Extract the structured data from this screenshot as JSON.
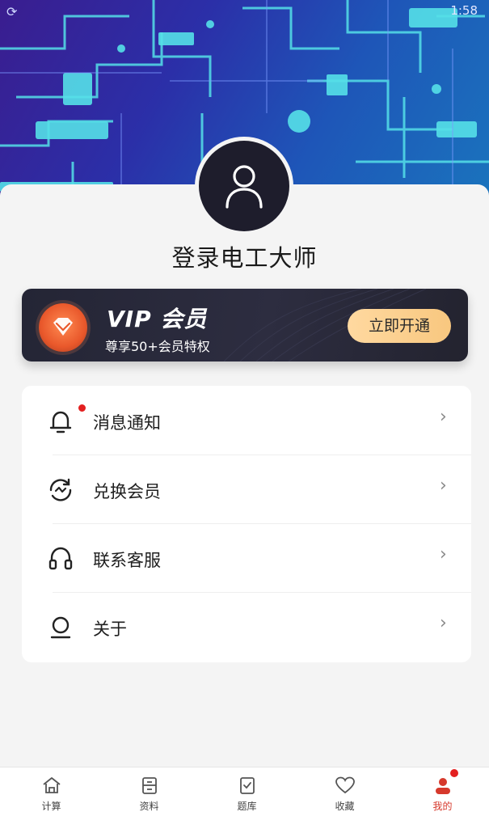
{
  "status_bar": {
    "left_icon": "sync-icon",
    "time": "1:58"
  },
  "profile": {
    "avatar_icon": "user-icon",
    "login_text": "登录电工大师"
  },
  "vip_card": {
    "badge_icon": "diamond-icon",
    "title": "VIP 会员",
    "subtitle": "尊享50+会员特权",
    "button_label": "立即开通",
    "accent_color": "#f8c77f"
  },
  "menu": {
    "items": [
      {
        "icon": "bell-icon",
        "label": "消息通知",
        "has_dot": true
      },
      {
        "icon": "exchange-icon",
        "label": "兑换会员",
        "has_dot": false
      },
      {
        "icon": "headset-icon",
        "label": "联系客服",
        "has_dot": false
      },
      {
        "icon": "about-icon",
        "label": "关于",
        "has_dot": false
      }
    ]
  },
  "tabbar": {
    "active_color": "#d6392c",
    "tabs": [
      {
        "icon": "home-icon",
        "label": "计算"
      },
      {
        "icon": "document-icon",
        "label": "资料"
      },
      {
        "icon": "quiz-icon",
        "label": "题库"
      },
      {
        "icon": "heart-icon",
        "label": "收藏"
      },
      {
        "icon": "profile-icon",
        "label": "我的",
        "active": true
      }
    ]
  }
}
